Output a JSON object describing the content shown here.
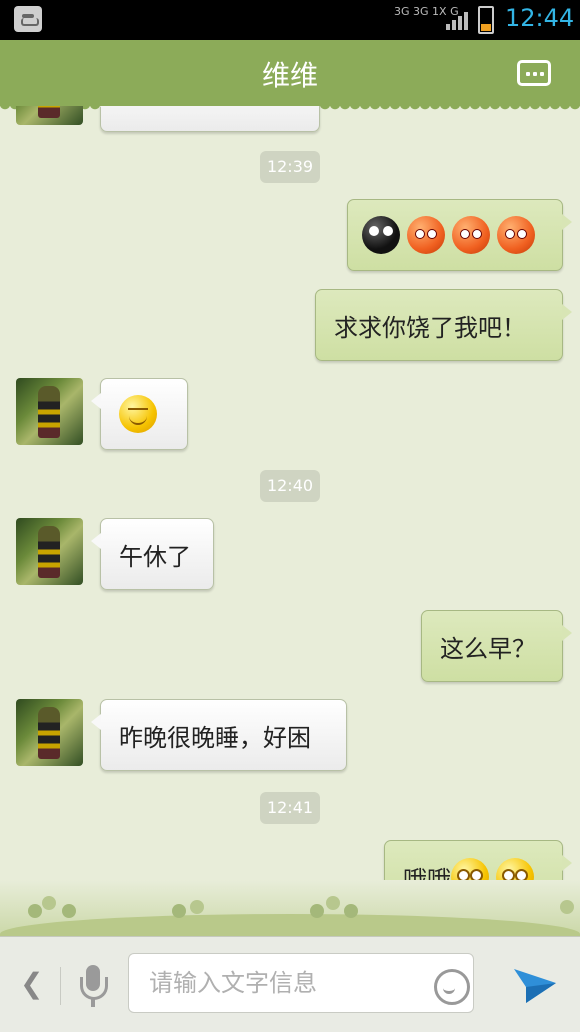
{
  "status_bar": {
    "network": "3G 3G 1X G",
    "time": "12:44"
  },
  "header": {
    "title": "维维"
  },
  "messages": [
    {
      "type": "incoming_partial",
      "text": ""
    },
    {
      "type": "timestamp",
      "text": "12:39"
    },
    {
      "type": "outgoing",
      "emoticons": [
        "sad-black-icon",
        "angry-icon",
        "angry-icon",
        "angry-icon"
      ]
    },
    {
      "type": "outgoing",
      "text": "求求你饶了我吧！"
    },
    {
      "type": "incoming",
      "emoticons": [
        "smile-icon"
      ]
    },
    {
      "type": "timestamp",
      "text": "12:40"
    },
    {
      "type": "incoming",
      "text": "午休了"
    },
    {
      "type": "outgoing",
      "text": "这么早？"
    },
    {
      "type": "incoming",
      "text": "昨晚很晚睡，好困"
    },
    {
      "type": "timestamp",
      "text": "12:41"
    },
    {
      "type": "outgoing",
      "text": "哦哦",
      "emoticons": [
        "doubt-icon",
        "doubt-icon"
      ]
    }
  ],
  "input_bar": {
    "placeholder": "请输入文字信息"
  },
  "colors": {
    "header": "#8cab59",
    "outgoing_bubble": "#d5e4ad",
    "incoming_bubble": "#ffffff",
    "background": "#e8edd9",
    "status_time": "#33b5e5"
  }
}
